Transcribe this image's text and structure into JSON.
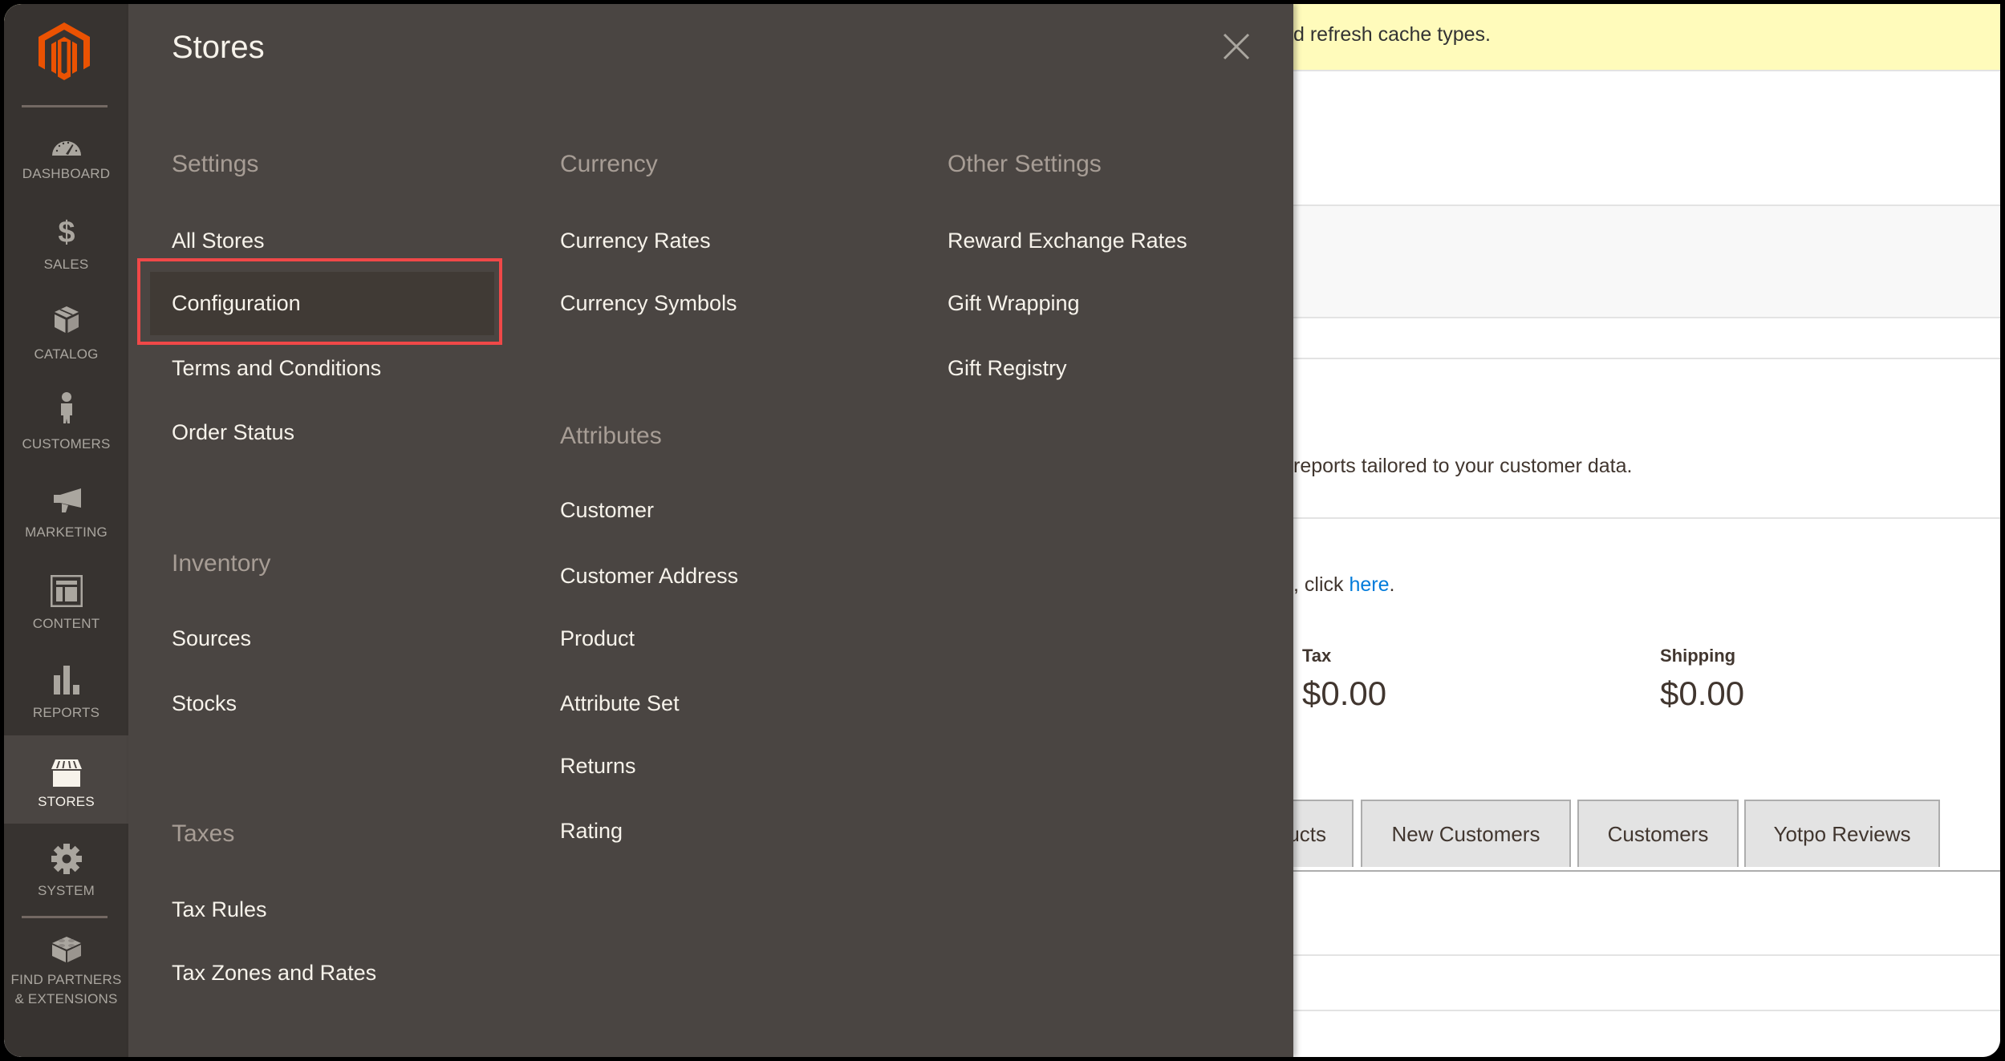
{
  "sidebar": {
    "logo": "magento-logo",
    "items": [
      {
        "label": "DASHBOARD",
        "icon": "dashboard-gauge-icon",
        "active": false
      },
      {
        "label": "SALES",
        "icon": "dollar-icon",
        "active": false
      },
      {
        "label": "CATALOG",
        "icon": "box-icon",
        "active": false
      },
      {
        "label": "CUSTOMERS",
        "icon": "person-icon",
        "active": false
      },
      {
        "label": "MARKETING",
        "icon": "megaphone-icon",
        "active": false
      },
      {
        "label": "CONTENT",
        "icon": "layout-icon",
        "active": false
      },
      {
        "label": "REPORTS",
        "icon": "bar-chart-icon",
        "active": false
      },
      {
        "label": "STORES",
        "icon": "storefront-icon",
        "active": true
      },
      {
        "label": "SYSTEM",
        "icon": "gear-icon",
        "active": false
      },
      {
        "label_line1": "FIND PARTNERS",
        "label_line2": "& EXTENSIONS",
        "icon": "lego-brick-icon",
        "active": false
      }
    ]
  },
  "panel": {
    "title": "Stores",
    "close_icon": "close-icon",
    "groups": {
      "settings": {
        "title": "Settings",
        "items": [
          "All Stores",
          "Configuration",
          "Terms and Conditions",
          "Order Status"
        ],
        "highlighted": "Configuration"
      },
      "inventory": {
        "title": "Inventory",
        "items": [
          "Sources",
          "Stocks"
        ]
      },
      "taxes": {
        "title": "Taxes",
        "items": [
          "Tax Rules",
          "Tax Zones and Rates"
        ]
      },
      "currency": {
        "title": "Currency",
        "items": [
          "Currency Rates",
          "Currency Symbols"
        ]
      },
      "attributes": {
        "title": "Attributes",
        "items": [
          "Customer",
          "Customer Address",
          "Product",
          "Attribute Set",
          "Returns",
          "Rating"
        ]
      },
      "other_settings": {
        "title": "Other Settings",
        "items": [
          "Reward Exchange Rates",
          "Gift Wrapping",
          "Gift Registry"
        ]
      }
    }
  },
  "background": {
    "banner_text": "d refresh cache types.",
    "info_text": "reports tailored to your customer data.",
    "click_prefix": ", click ",
    "click_link": "here",
    "click_suffix": ".",
    "stats": [
      {
        "label": "Tax",
        "value": "$0.00"
      },
      {
        "label": "Shipping",
        "value": "$0.00"
      }
    ],
    "tabs": [
      "ucts",
      "New Customers",
      "Customers",
      "Yotpo Reviews"
    ]
  },
  "colors": {
    "sidebar_bg": "#373330",
    "panel_bg": "#4a4542",
    "accent_logo": "#eb5202",
    "highlight_outline": "#f04848",
    "link": "#007bdb",
    "banner_bg": "#fffbbb"
  }
}
